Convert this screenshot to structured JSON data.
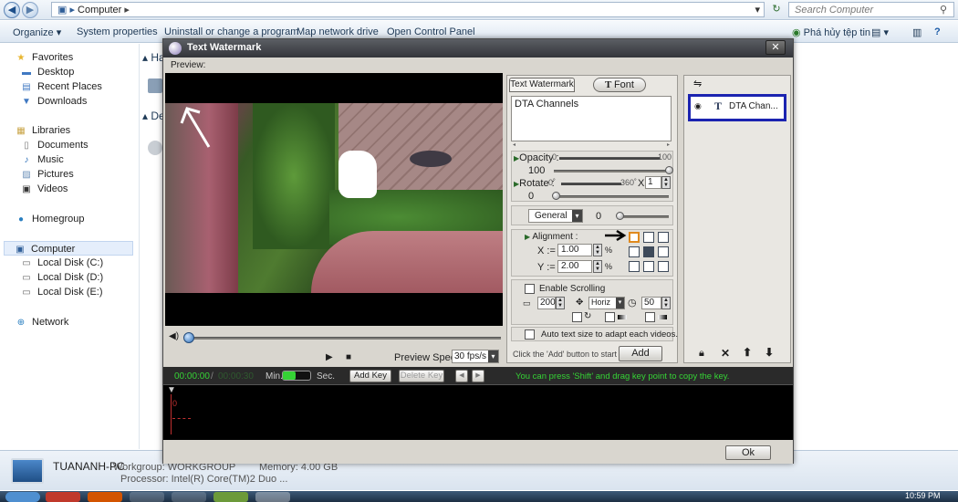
{
  "explorer": {
    "breadcrumb": "Computer",
    "search_placeholder": "Search Computer",
    "commands": [
      "Organize ▾",
      "System properties",
      "Uninstall or change a program",
      "Map network drive",
      "Open Control Panel"
    ],
    "right_command": "Phá hủy tệp tin",
    "nav": {
      "favorites": "Favorites",
      "desktop": "Desktop",
      "recent": "Recent Places",
      "downloads": "Downloads",
      "libraries": "Libraries",
      "documents": "Documents",
      "music": "Music",
      "pictures": "Pictures",
      "videos": "Videos",
      "homegroup": "Homegroup",
      "computer": "Computer",
      "disk_c": "Local Disk (C:)",
      "disk_d": "Local Disk (D:)",
      "disk_e": "Local Disk (E:)",
      "network": "Network"
    },
    "content_partial_1": "Ha",
    "content_partial_2": "De",
    "status": {
      "pc_name": "TUANANH-PC",
      "workgroup": "Workgroup: WORKGROUP",
      "memory": "Memory: 4.00 GB",
      "processor": "Processor: Intel(R) Core(TM)2 Duo ..."
    },
    "clock": "10:59 PM"
  },
  "dialog": {
    "title": "Text Watermark",
    "preview_label": "Preview:",
    "tab_watermark": "Text Watermark",
    "tab_font": "Font",
    "text_value": "DTA Channels",
    "opacity_label": "Opacity :",
    "opacity_min": "0",
    "opacity_max": "100",
    "opacity_value": "100",
    "rotate_label": "Rotate :",
    "rotate_min": "0˚",
    "rotate_max": "360˚",
    "rotate_mult_label": "X",
    "rotate_mult": "1",
    "rotate_value": "0",
    "blend_mode": "General",
    "blend_value": "0",
    "alignment_label": "Alignment :",
    "x_label": "X :=",
    "x_value": "1.00",
    "y_label": "Y :=",
    "y_value": "2.00",
    "percent": "%",
    "enable_scrolling": "Enable Scrolling",
    "scroll_width": "200",
    "scroll_dir": "Horiz",
    "scroll_speed": "50",
    "auto_text": "Auto text size to adapt each videos.",
    "add_hint": "Click the 'Add' button to start ->",
    "add_button": "Add",
    "preview_speed_label": "Preview Speed:",
    "preview_speed": "30 fps/s",
    "time_current": "00:00:00",
    "time_sep": "/",
    "time_total": "00:00:30",
    "min_label": "Min.",
    "sec_label": "Sec.",
    "add_key": "Add Key",
    "delete_key": "Delete Key",
    "key_hint": "You can press 'Shift' and drag key point to copy the key.",
    "timeline_zero": "0",
    "ok_button": "Ok",
    "layer_item": "DTA Chan...",
    "colors": {
      "accent_border": "#1b23b0",
      "hint_green": "#35d335",
      "timeline_bg": "#000000"
    }
  }
}
